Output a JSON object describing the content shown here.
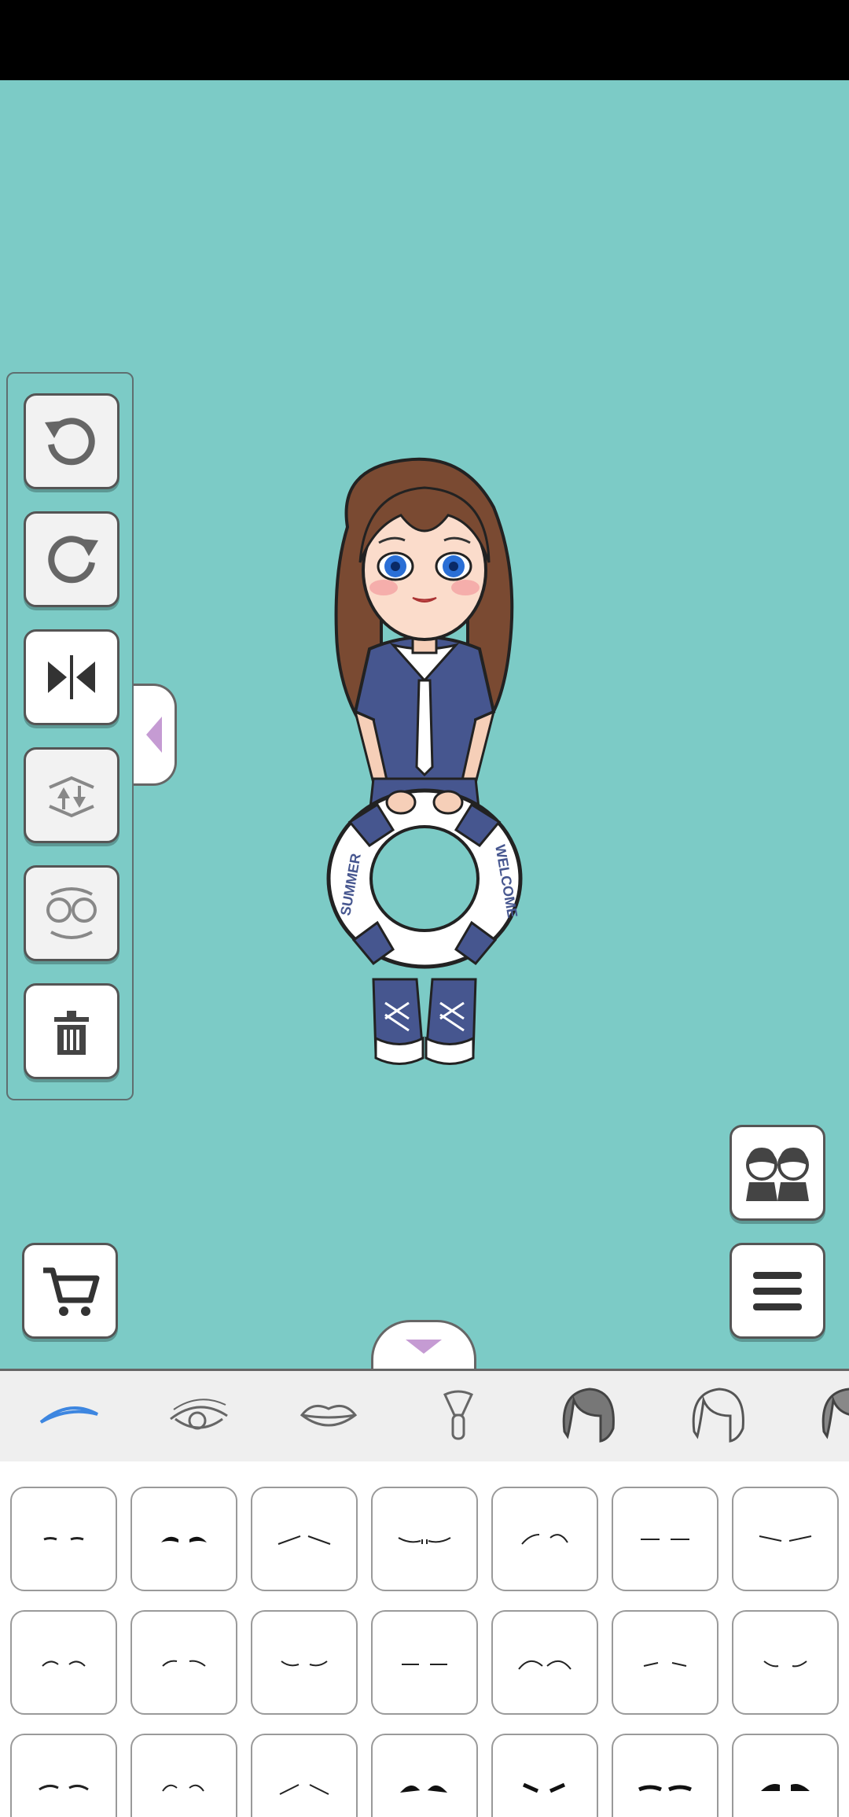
{
  "toolbar": {
    "buttons": [
      {
        "name": "undo-button",
        "icon": "undo-icon"
      },
      {
        "name": "redo-button",
        "icon": "redo-icon"
      },
      {
        "name": "flip-button",
        "icon": "flip-horizontal-icon"
      },
      {
        "name": "layer-button",
        "icon": "layer-swap-icon"
      },
      {
        "name": "swap-character-button",
        "icon": "character-swap-icon"
      },
      {
        "name": "delete-button",
        "icon": "trash-icon"
      }
    ]
  },
  "character": {
    "ring_text_left": "SUMMER",
    "ring_text_right": "WELCOME"
  },
  "side_buttons": {
    "characters": "characters-icon",
    "cart": "cart-icon",
    "menu": "menu-icon"
  },
  "tabs": [
    {
      "name": "eyebrows",
      "icon": "eyebrow-icon",
      "active": true
    },
    {
      "name": "eyes",
      "icon": "eye-icon",
      "active": false
    },
    {
      "name": "lips",
      "icon": "lips-icon",
      "active": false
    },
    {
      "name": "blush",
      "icon": "brush-icon",
      "active": false
    },
    {
      "name": "hair-front",
      "icon": "hair-dark-icon",
      "active": false
    },
    {
      "name": "hair-back",
      "icon": "hair-outline-icon",
      "active": false
    },
    {
      "name": "hair-extra",
      "icon": "hair-partial-icon",
      "active": false
    }
  ],
  "colors": {
    "background": "#7ccbc6",
    "accent": "#3d86e0",
    "arrow": "#c59bd3"
  }
}
